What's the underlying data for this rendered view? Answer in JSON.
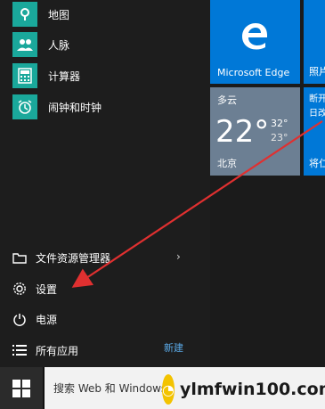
{
  "apps": [
    {
      "label": "地图",
      "icon": "map-pin-icon"
    },
    {
      "label": "人脉",
      "icon": "people-icon"
    },
    {
      "label": "计算器",
      "icon": "calculator-icon"
    },
    {
      "label": "闹钟和时钟",
      "icon": "alarm-clock-icon"
    }
  ],
  "bottom": {
    "file_explorer": "文件资源管理器",
    "settings": "设置",
    "power": "电源",
    "all_apps": "所有应用",
    "new_tag": "新建"
  },
  "tiles": {
    "edge_label": "Microsoft Edge",
    "photos_label": "照片",
    "news_line1": "断开",
    "news_line2": "日改",
    "news_label": "将仁"
  },
  "weather": {
    "condition": "多云",
    "temp": "22°",
    "high": "32°",
    "low": "23°",
    "city": "北京"
  },
  "taskbar": {
    "search_placeholder": "搜索 Web 和 Windows"
  },
  "watermark": {
    "text": "ylmfwin100.com"
  },
  "colors": {
    "tile_blue": "#0078d7",
    "weather_tile": "#6c7f93",
    "arrow": "#e03030",
    "accent": "#5aa9e6"
  }
}
